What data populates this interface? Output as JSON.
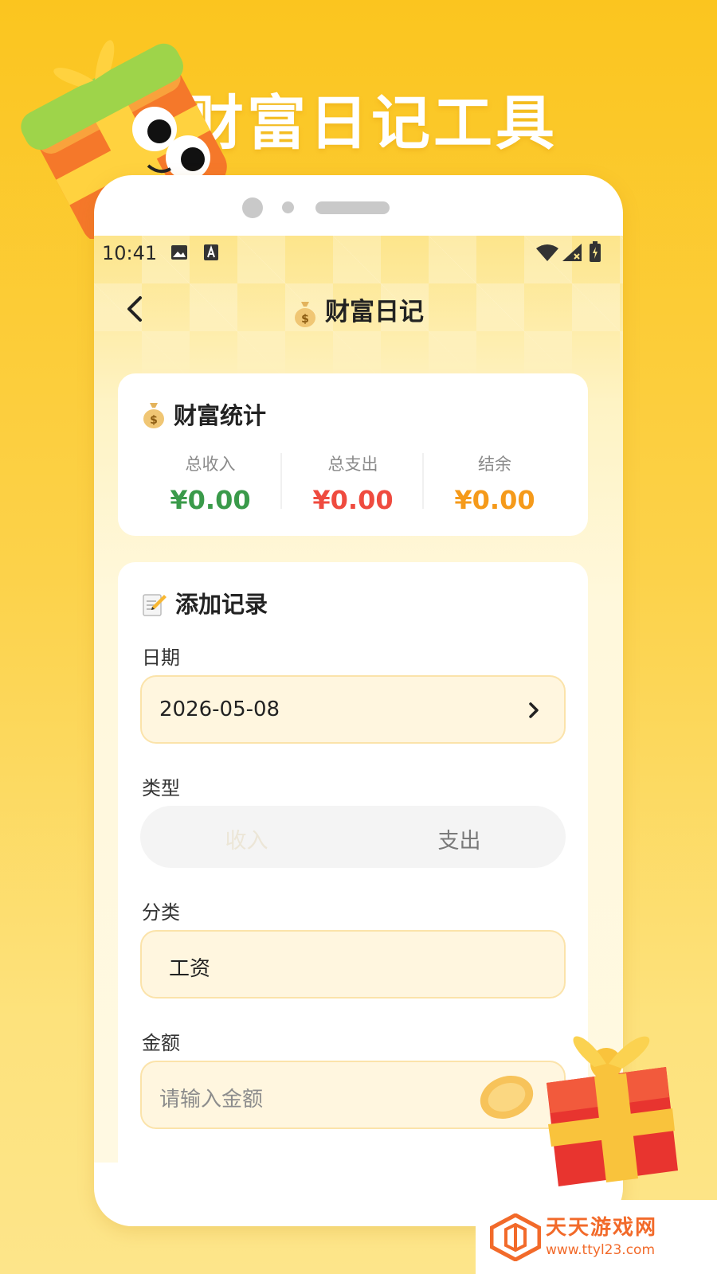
{
  "headline": "财富日记工具",
  "status_bar": {
    "time": "10:41"
  },
  "nav": {
    "title": "财富日记",
    "back_icon": "chevron-left-icon",
    "title_icon": "money-bag-icon"
  },
  "stats": {
    "title": "财富统计",
    "title_icon": "money-bag-icon",
    "items": [
      {
        "label": "总收入",
        "value": "¥0.00",
        "color": "#3a9a4a"
      },
      {
        "label": "总支出",
        "value": "¥0.00",
        "color": "#ef4b3f"
      },
      {
        "label": "结余",
        "value": "¥0.00",
        "color": "#f59a1a"
      }
    ]
  },
  "form": {
    "title": "添加记录",
    "title_icon": "memo-pencil-icon",
    "date": {
      "label": "日期",
      "value": "2026-05-08"
    },
    "type": {
      "label": "类型",
      "options": [
        "收入",
        "支出"
      ],
      "selected": "收入"
    },
    "category": {
      "label": "分类",
      "value": "工资"
    },
    "amount": {
      "label": "金额",
      "placeholder": "请输入金额"
    }
  },
  "watermark": {
    "name": "天天游戏网",
    "url": "www.ttyl23.com"
  }
}
